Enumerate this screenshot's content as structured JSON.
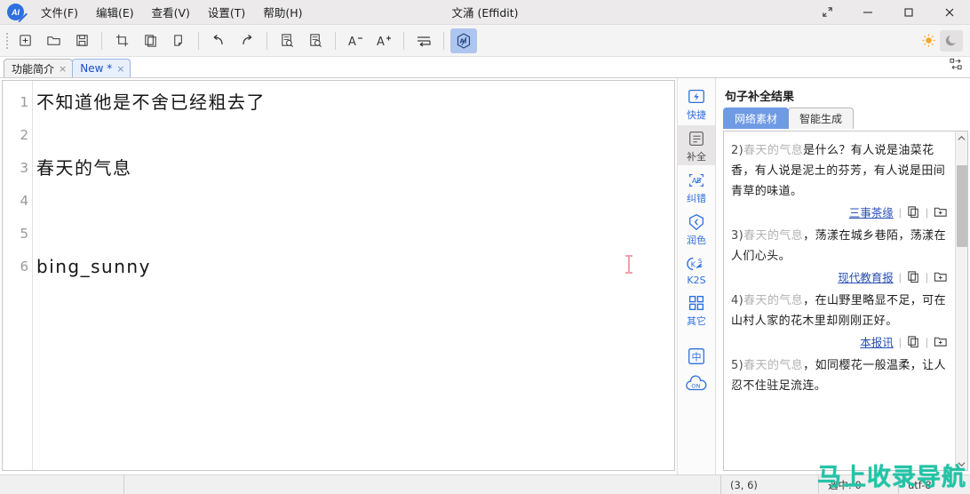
{
  "window": {
    "title": "文涌 (Effidit)",
    "logo_text": "AI",
    "restore_icon": "expand-diagonal-icon",
    "minimize_icon": "minimize-icon",
    "maximize_icon": "maximize-icon",
    "close_icon": "close-icon"
  },
  "menu": [
    {
      "label": "文件(F)",
      "name": "menu-file"
    },
    {
      "label": "编辑(E)",
      "name": "menu-edit"
    },
    {
      "label": "查看(V)",
      "name": "menu-view"
    },
    {
      "label": "设置(T)",
      "name": "menu-settings"
    },
    {
      "label": "帮助(H)",
      "name": "menu-help"
    }
  ],
  "toolbar": {
    "buttons": [
      "new-file-icon",
      "open-folder-icon",
      "save-icon",
      "cut-icon",
      "copy-icon",
      "paste-icon",
      "undo-icon",
      "redo-icon",
      "find-icon",
      "replace-icon",
      "decrease-font-icon",
      "increase-font-icon",
      "indent-icon",
      "ai-assistant-icon"
    ],
    "ai_label": "AI",
    "theme_light_icon": "sun-icon",
    "theme_dark_icon": "moon-icon",
    "layout_icon": "layout-toggle-icon"
  },
  "tabs": [
    {
      "label": "功能简介",
      "active": false,
      "close": "×"
    },
    {
      "label": "New *",
      "active": true,
      "close": "×"
    }
  ],
  "editor": {
    "line_numbers": [
      "1",
      "2",
      "3",
      "4",
      "5",
      "6"
    ],
    "lines": [
      "不知道他是不舍已经粗去了",
      "",
      "春天的气息",
      "",
      "",
      "bing_sunny"
    ]
  },
  "rail": [
    {
      "label": "快捷",
      "icon": "lightning-icon",
      "selected": false
    },
    {
      "label": "补全",
      "icon": "completion-icon",
      "selected": true
    },
    {
      "label": "纠错",
      "icon": "spellcheck-icon",
      "selected": false
    },
    {
      "label": "润色",
      "icon": "polish-icon",
      "selected": false
    },
    {
      "label": "K2S",
      "icon": "keywords-to-sentence-icon",
      "selected": false
    },
    {
      "label": "其它",
      "icon": "more-grid-icon",
      "selected": false
    },
    {
      "label": "",
      "icon": "language-chinese-icon",
      "selected": false,
      "glyph": "中"
    },
    {
      "label": "",
      "icon": "cloud-on-icon",
      "selected": false,
      "glyph": "ON"
    }
  ],
  "panel": {
    "title": "句子补全结果",
    "tabs": [
      {
        "label": "网络素材",
        "active": true
      },
      {
        "label": "智能生成",
        "active": false
      }
    ],
    "results": [
      {
        "index": "2)",
        "prefix": "春天的气息",
        "text": "是什么？有人说是油菜花香，有人说是泥土的芬芳，有人说是田间青草的味道。",
        "source": "三事茶缘",
        "copy_icon": "copy-icon",
        "insert_icon": "insert-icon"
      },
      {
        "index": "3)",
        "prefix": "春天的气息",
        "text": "，荡漾在城乡巷陌，荡漾在人们心头。",
        "source": "现代教育报",
        "copy_icon": "copy-icon",
        "insert_icon": "insert-icon"
      },
      {
        "index": "4)",
        "prefix": "春天的气息",
        "text": "，在山野里略显不足，可在山村人家的花木里却刚刚正好。",
        "source": "本报讯",
        "copy_icon": "copy-icon",
        "insert_icon": "insert-icon"
      },
      {
        "index": "5)",
        "prefix": "春天的气息",
        "text": "，如同樱花一般温柔，让人忍不住驻足流连。",
        "source": "",
        "copy_icon": "copy-icon",
        "insert_icon": "insert-icon"
      }
    ],
    "scroll_up_icon": "chevron-up-icon",
    "scroll_down_icon": "chevron-down-icon"
  },
  "statusbar": {
    "cursor_position": "(3, 6)",
    "selection": "选中: 0",
    "encoding": "utf-8"
  },
  "watermark": "马上收录导航",
  "colors": {
    "accent": "#2f6fe0",
    "tab_active": "#6f9ae4",
    "link": "#2a4fb5",
    "watermark": "#22c3a6",
    "caret": "#f2a0ad"
  }
}
